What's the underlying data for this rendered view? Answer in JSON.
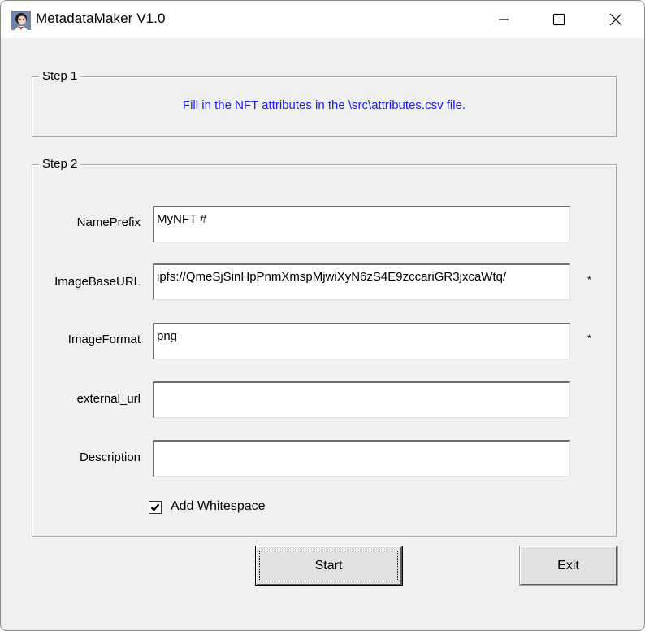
{
  "window": {
    "title": "MetadataMaker V1.0",
    "icons": {
      "app": "app-avatar-icon",
      "minimize": "minimize-icon",
      "maximize": "maximize-icon",
      "close": "close-icon"
    }
  },
  "step1": {
    "legend": "Step 1",
    "info": "Fill in the NFT attributes in the \\src\\attributes.csv file.",
    "info_color": "#1a1aff"
  },
  "step2": {
    "legend": "Step 2",
    "fields": [
      {
        "label": "NamePrefix",
        "value": "MyNFT #",
        "required_mark": ""
      },
      {
        "label": "ImageBaseURL",
        "value": "ipfs://QmeSjSinHpPnmXmspMjwiXyN6zS4E9zccariGR3jxcaWtq/",
        "required_mark": "*"
      },
      {
        "label": "ImageFormat",
        "value": "png",
        "required_mark": "*"
      },
      {
        "label": "external_url",
        "value": "",
        "required_mark": ""
      },
      {
        "label": "Description",
        "value": "",
        "required_mark": ""
      }
    ],
    "checkbox": {
      "label": "Add Whitespace",
      "checked": true
    }
  },
  "buttons": {
    "start": "Start",
    "exit": "Exit"
  }
}
